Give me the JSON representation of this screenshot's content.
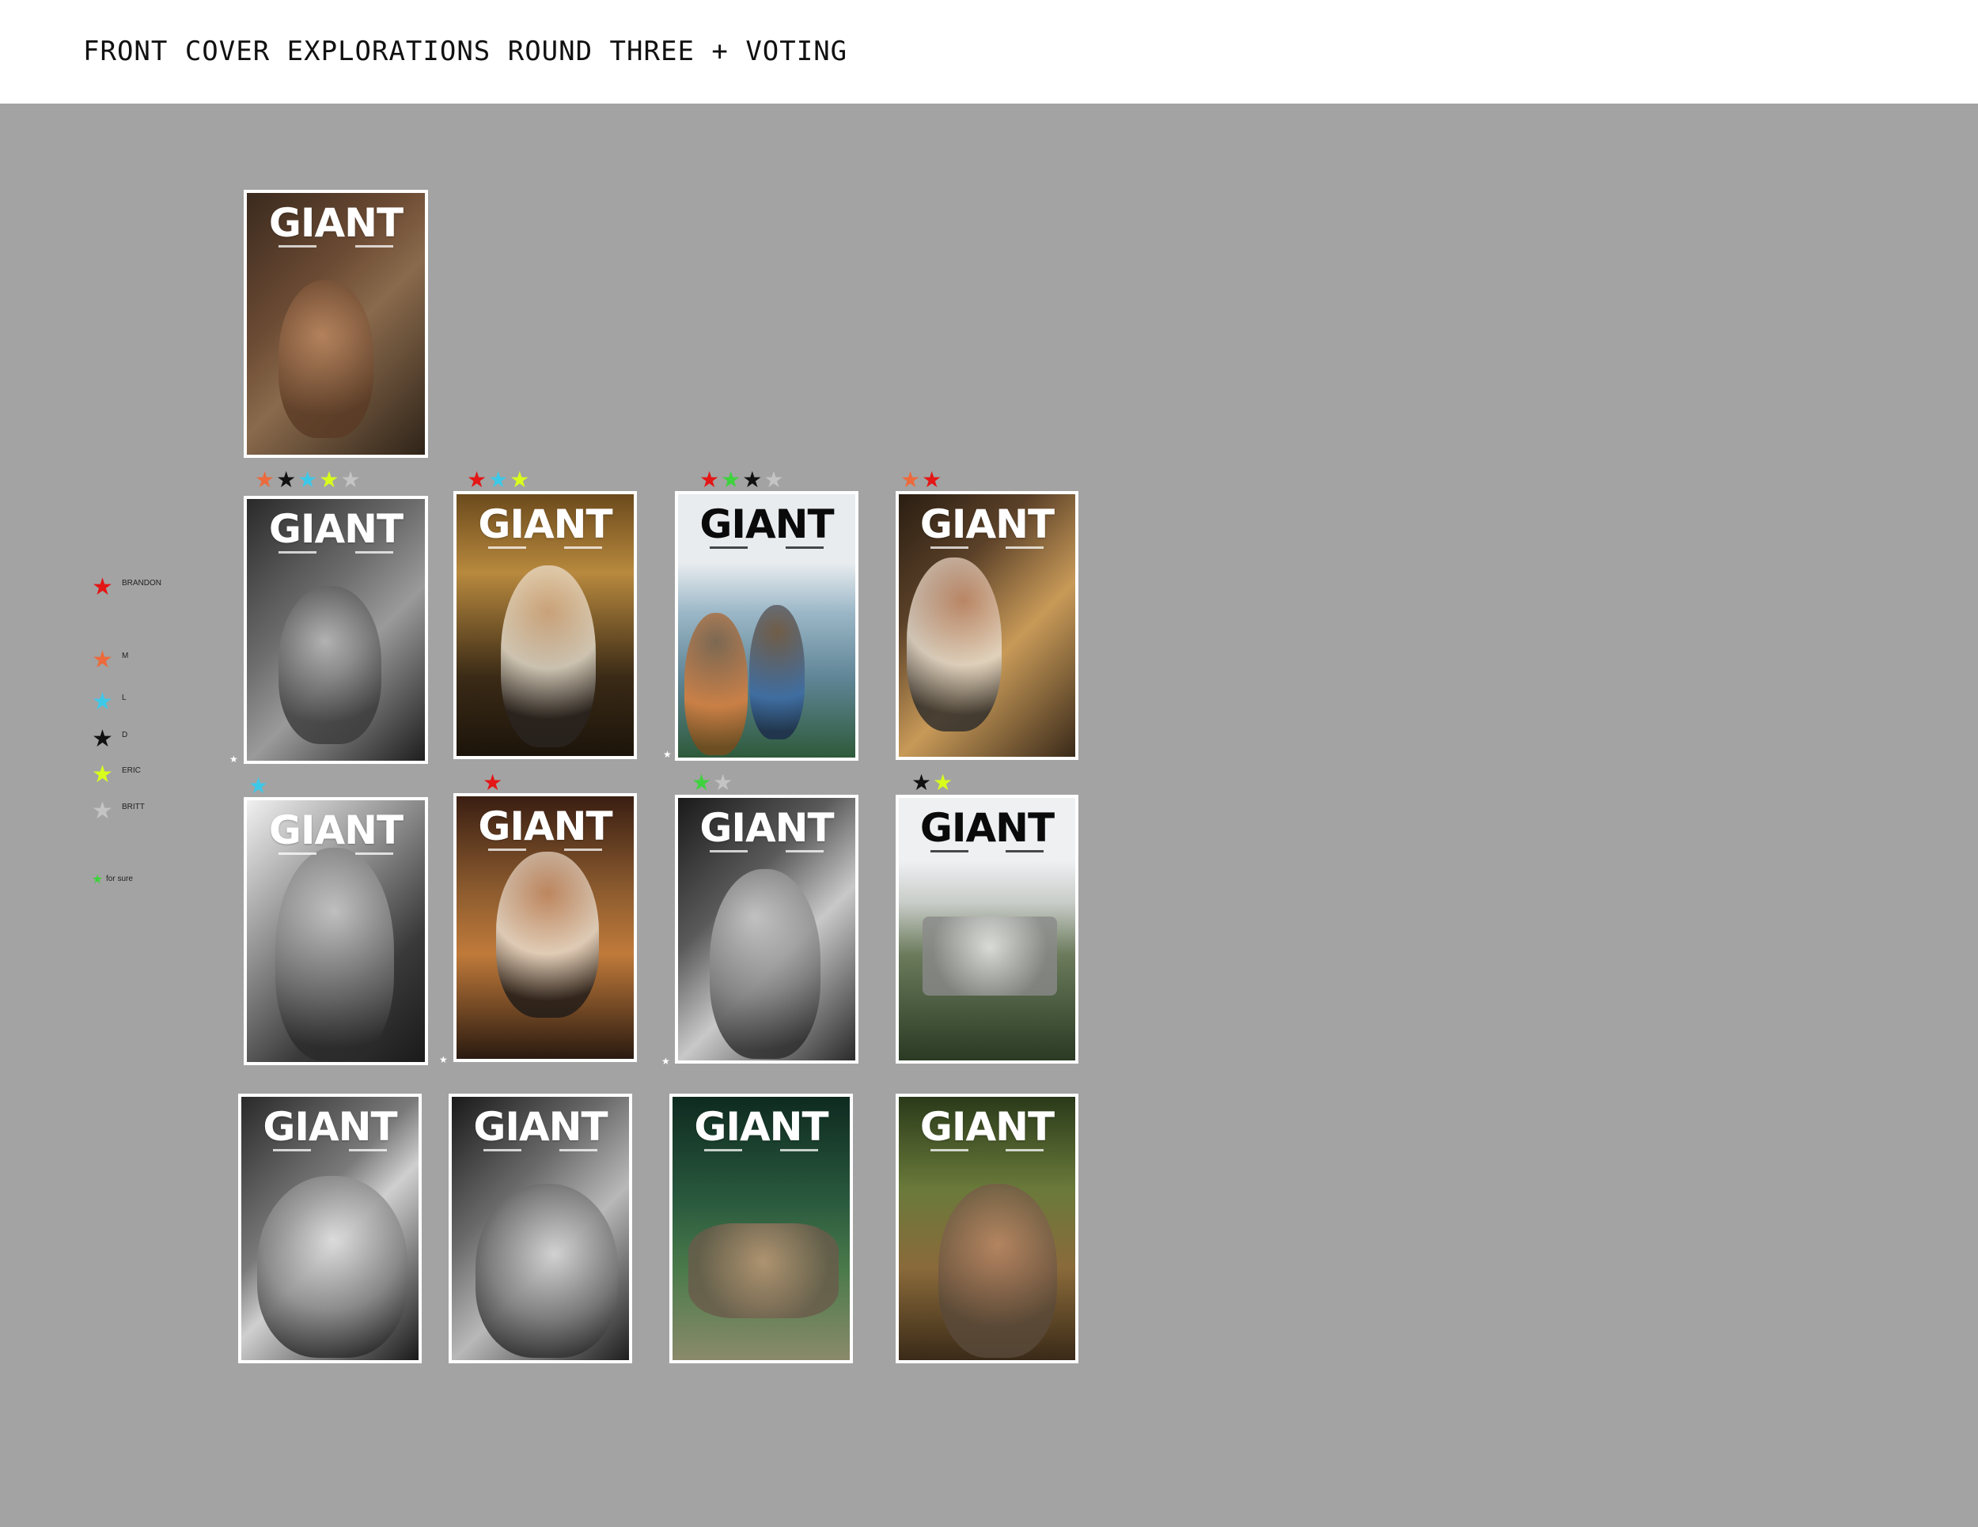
{
  "header": {
    "title": "FRONT COVER EXPLORATIONS ROUND THREE + VOTING"
  },
  "colors": {
    "red": "#e41616",
    "orange": "#ec6a3c",
    "cyan": "#3ec8e8",
    "black": "#111111",
    "yellow": "#d8ff1c",
    "gray": "#c4c4c4",
    "green": "#3ed23e",
    "white": "#ffffff"
  },
  "legend": [
    {
      "label": "BRANDON",
      "color": "red"
    },
    {
      "label": "M",
      "color": "orange"
    },
    {
      "label": "L",
      "color": "cyan"
    },
    {
      "label": "D",
      "color": "black"
    },
    {
      "label": "ERIC",
      "color": "yellow"
    },
    {
      "label": "BRITT",
      "color": "gray"
    },
    {
      "label": "for sure",
      "color": "green"
    }
  ],
  "covers": [
    {
      "masthead": "GIANT",
      "theme": "warm-portrait-boots",
      "votes": []
    },
    {
      "masthead": "GIANT",
      "theme": "bw-boots",
      "votes": [
        "orange",
        "black",
        "cyan",
        "yellow",
        "gray"
      ]
    },
    {
      "masthead": "GIANT",
      "theme": "warm-chef",
      "votes": [
        "red",
        "cyan",
        "yellow"
      ]
    },
    {
      "masthead": "GIANT",
      "theme": "boat-fisherman",
      "votes": [
        "red",
        "green",
        "black",
        "gray"
      ]
    },
    {
      "masthead": "GIANT",
      "theme": "kitchen-closeup",
      "votes": [
        "orange",
        "red"
      ]
    },
    {
      "masthead": "GIANT",
      "theme": "bw-smiling-man",
      "votes": [
        "cyan"
      ]
    },
    {
      "masthead": "GIANT",
      "theme": "kitchen-team",
      "votes": [
        "red"
      ]
    },
    {
      "masthead": "GIANT",
      "theme": "bw-fire-truck",
      "votes": [
        "green",
        "gray"
      ]
    },
    {
      "masthead": "GIANT",
      "theme": "dock-boat",
      "votes": [
        "black",
        "yellow"
      ]
    },
    {
      "masthead": "GIANT",
      "theme": "bw-shirtless-1",
      "votes": []
    },
    {
      "masthead": "GIANT",
      "theme": "bw-shirtless-2",
      "votes": []
    },
    {
      "masthead": "GIANT",
      "theme": "forest-runners",
      "votes": []
    },
    {
      "masthead": "GIANT",
      "theme": "trail-runners",
      "votes": []
    }
  ],
  "icons": {
    "star": "star-icon"
  }
}
